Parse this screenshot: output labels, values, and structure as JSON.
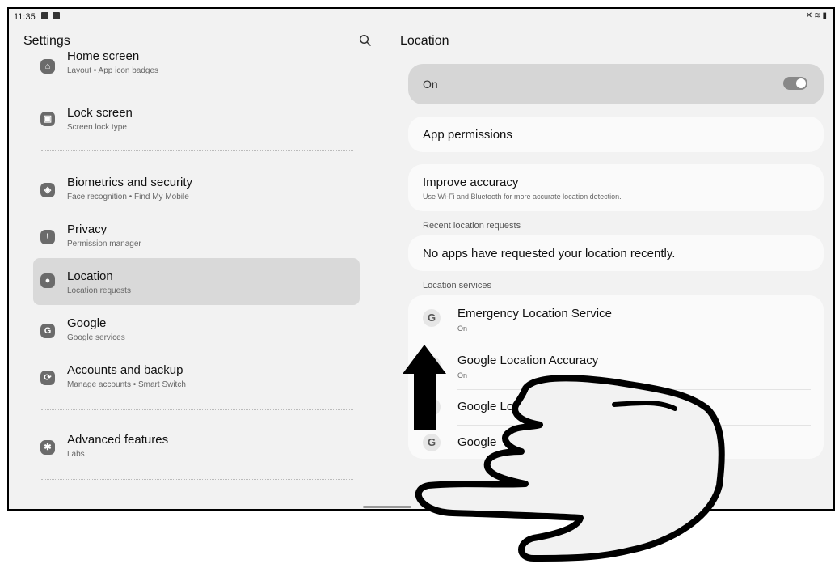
{
  "status_bar": {
    "time": "11:35",
    "right_icons": [
      "mute-icon",
      "wifi-icon",
      "battery-icon"
    ]
  },
  "left_panel": {
    "title": "Settings",
    "search_icon": "search-icon",
    "items": [
      {
        "title": "Home screen",
        "subtitle": "Layout  •  App icon badges",
        "icon": "home-icon"
      },
      {
        "title": "Lock screen",
        "subtitle": "Screen lock type",
        "icon": "lock-icon"
      },
      {
        "title": "Biometrics and security",
        "subtitle": "Face recognition  •  Find My Mobile",
        "icon": "shield-icon"
      },
      {
        "title": "Privacy",
        "subtitle": "Permission manager",
        "icon": "privacy-icon"
      },
      {
        "title": "Location",
        "subtitle": "Location requests",
        "icon": "location-icon",
        "selected": true
      },
      {
        "title": "Google",
        "subtitle": "Google services",
        "icon": "google-icon"
      },
      {
        "title": "Accounts and backup",
        "subtitle": "Manage accounts  •  Smart Switch",
        "icon": "sync-icon"
      },
      {
        "title": "Advanced features",
        "subtitle": "Labs",
        "icon": "gear-plus-icon"
      }
    ]
  },
  "right_panel": {
    "title": "Location",
    "master_toggle": {
      "label": "On",
      "state": "on"
    },
    "app_permissions": "App permissions",
    "improve_accuracy": {
      "title": "Improve accuracy",
      "subtitle": "Use Wi-Fi and Bluetooth for more accurate location detection."
    },
    "recent_requests_label": "Recent location requests",
    "recent_requests_text": "No apps have requested your location recently.",
    "services_label": "Location services",
    "services": [
      {
        "title": "Emergency Location Service",
        "status": "On"
      },
      {
        "title": "Google Location Accuracy",
        "status": "On"
      },
      {
        "title": "Google Loc"
      },
      {
        "title": "Google"
      }
    ]
  },
  "colors": {
    "screen_bg": "#f2f2f2",
    "selected_item": "#d9d9d9",
    "toggle_card": "#d6d6d6"
  },
  "overlay": {
    "gesture": "swipe-up",
    "icons": [
      "up-arrow-icon",
      "hand-pointer-icon"
    ]
  }
}
